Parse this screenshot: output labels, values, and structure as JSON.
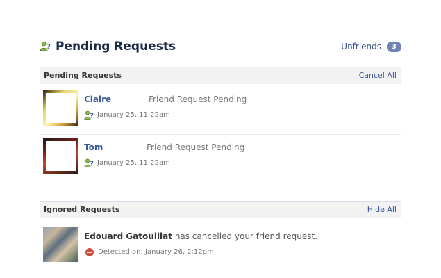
{
  "header": {
    "title": "Pending Requests",
    "icon": "friend-question-icon",
    "unfriends_label": "Unfriends",
    "unfriends_count": "3"
  },
  "pending_section": {
    "title": "Pending Requests",
    "action": "Cancel All",
    "requests": [
      {
        "name": "Claire",
        "status": "Friend Request Pending",
        "date": "January 25, 11:22am"
      },
      {
        "name": "Tom",
        "status": "Friend Request Pending",
        "date": "January 25, 11:22am"
      }
    ]
  },
  "ignored_section": {
    "title": "Ignored Requests",
    "action": "Hide All",
    "items": [
      {
        "name": "Edouard Gatouillat",
        "message": " has cancelled your friend request.",
        "detected": "Detected on: January 26, 2:12pm"
      }
    ]
  },
  "colors": {
    "link": "#3b5998",
    "title": "#1c2a47",
    "badge": "#6d84b4",
    "section_bg": "#f2f2f2",
    "stop_icon": "#d44a3a"
  }
}
